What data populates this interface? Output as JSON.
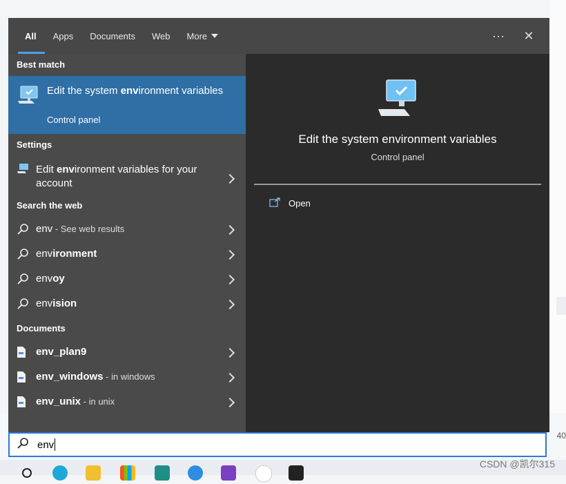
{
  "tabs": [
    {
      "label": "All",
      "active": true
    },
    {
      "label": "Apps"
    },
    {
      "label": "Documents"
    },
    {
      "label": "Web"
    },
    {
      "label": "More"
    }
  ],
  "toolbar": {
    "more_label": "···",
    "close_label": "✕"
  },
  "sections": {
    "best_match": "Best match",
    "settings": "Settings",
    "search_web": "Search the web",
    "documents": "Documents"
  },
  "best_match": {
    "title_pre": "Edit the system ",
    "title_bold": "env",
    "title_post": "ironment variables",
    "subtitle": "Control panel"
  },
  "settings_item": {
    "pre": "Edit ",
    "bold": "env",
    "post": "ironment variables for your account"
  },
  "web_results": [
    {
      "bold": "env",
      "rest": "",
      "hint": " - See web results"
    },
    {
      "bold": "env",
      "rest": "ironment",
      "rest_bold": true
    },
    {
      "bold": "env",
      "rest": "oy",
      "rest_bold": true
    },
    {
      "bold": "env",
      "rest": "ision",
      "rest_bold": true
    }
  ],
  "documents": [
    {
      "name": "env_plan9",
      "hint": ""
    },
    {
      "name": "env_windows",
      "hint": " - in windows"
    },
    {
      "name": "env_unix",
      "hint": " - in unix"
    }
  ],
  "detail": {
    "title": "Edit the system environment variables",
    "subtitle": "Control panel",
    "open_label": "Open"
  },
  "search": {
    "value": "env"
  },
  "colors": {
    "accent": "#4aa3ea",
    "selection": "#2f6fa6",
    "panel_left": "#4a4a4a",
    "panel_right": "#2b2b2b"
  },
  "watermark": "CSDN @凯尔315",
  "edge_text": "  40"
}
